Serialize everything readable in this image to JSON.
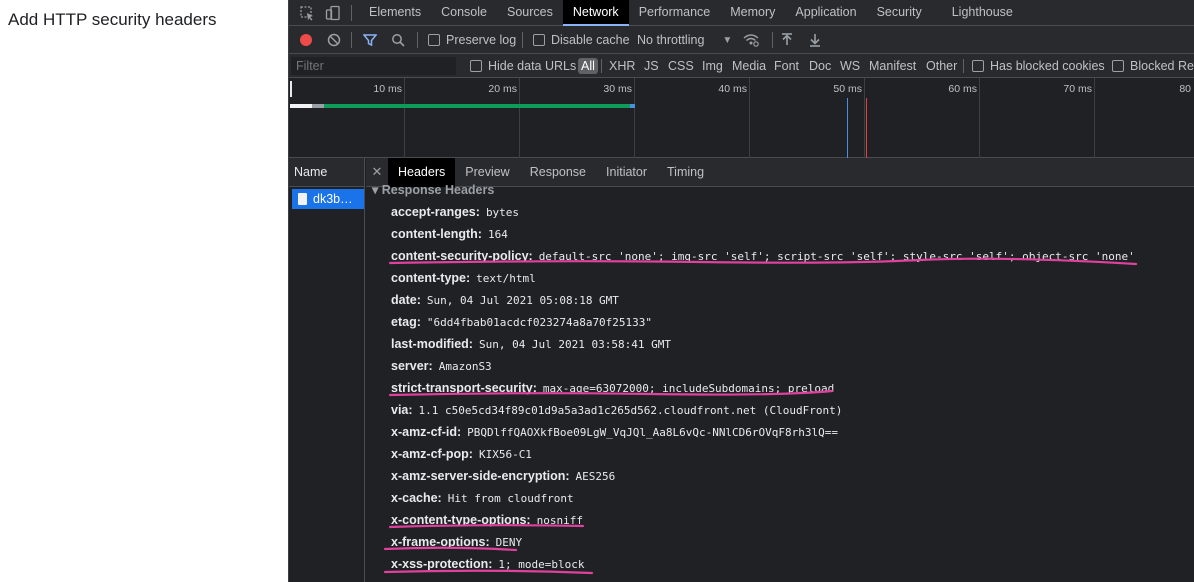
{
  "page": {
    "heading": "Add HTTP security headers"
  },
  "devtools": {
    "tabs": [
      "Elements",
      "Console",
      "Sources",
      "Network",
      "Performance",
      "Memory",
      "Application",
      "Security",
      "Lighthouse"
    ],
    "active_tab": "Network",
    "toolbar": {
      "preserve_log": "Preserve log",
      "disable_cache": "Disable cache",
      "throttling": "No throttling"
    },
    "filter": {
      "placeholder": "Filter",
      "hide_data_urls": "Hide data URLs",
      "all": "All",
      "types": [
        "XHR",
        "JS",
        "CSS",
        "Img",
        "Media",
        "Font",
        "Doc",
        "WS",
        "Manifest",
        "Other"
      ],
      "has_blocked_cookies": "Has blocked cookies",
      "blocked_requests": "Blocked Rec"
    },
    "timeline": {
      "ticks": [
        "10 ms",
        "20 ms",
        "30 ms",
        "40 ms",
        "50 ms",
        "60 ms",
        "70 ms",
        "80"
      ]
    },
    "requests": {
      "name_header": "Name",
      "items": [
        "dk3b…"
      ]
    },
    "detail": {
      "tabs": [
        "Headers",
        "Preview",
        "Response",
        "Initiator",
        "Timing"
      ],
      "active_tab": "Headers",
      "section_title": "▾ Response Headers",
      "headers": [
        {
          "key": "accept-ranges:",
          "value": "bytes"
        },
        {
          "key": "content-length:",
          "value": "164"
        },
        {
          "key": "content-security-policy:",
          "value": "default-src 'none'; img-src 'self'; script-src 'self'; style-src 'self'; object-src 'none'"
        },
        {
          "key": "content-type:",
          "value": "text/html"
        },
        {
          "key": "date:",
          "value": "Sun, 04 Jul 2021 05:08:18 GMT"
        },
        {
          "key": "etag:",
          "value": "\"6dd4fbab01acdcf023274a8a70f25133\""
        },
        {
          "key": "last-modified:",
          "value": "Sun, 04 Jul 2021 03:58:41 GMT"
        },
        {
          "key": "server:",
          "value": "AmazonS3"
        },
        {
          "key": "strict-transport-security:",
          "value": "max-age=63072000; includeSubdomains; preload"
        },
        {
          "key": "via:",
          "value": "1.1 c50e5cd34f89c01d9a5a3ad1c265d562.cloudfront.net (CloudFront)"
        },
        {
          "key": "x-amz-cf-id:",
          "value": "PBQDlffQAOXkfBoe09LgW_VqJQl_Aa8L6vQc-NNlCD6rOVqF8rh3lQ=="
        },
        {
          "key": "x-amz-cf-pop:",
          "value": "KIX56-C1"
        },
        {
          "key": "x-amz-server-side-encryption:",
          "value": "AES256"
        },
        {
          "key": "x-cache:",
          "value": "Hit from cloudfront"
        },
        {
          "key": "x-content-type-options:",
          "value": "nosniff"
        },
        {
          "key": "x-frame-options:",
          "value": "DENY"
        },
        {
          "key": "x-xss-protection:",
          "value": "1; mode=block"
        }
      ]
    }
  },
  "colors": {
    "annotation": "#e0409e",
    "record": "#ee4a4a",
    "filter_active": "#8ab4f8",
    "waterfall_bar": "#0d9d58",
    "dom_content_loaded": "#4a90e2",
    "load": "#e8413a"
  }
}
